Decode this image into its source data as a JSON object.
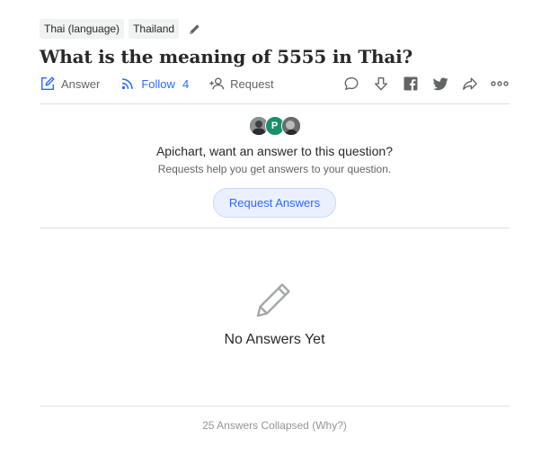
{
  "topics": [
    "Thai (language)",
    "Thailand"
  ],
  "question": {
    "title": "What is the meaning of 5555 in Thai?"
  },
  "actions": {
    "answer_label": "Answer",
    "follow_label": "Follow",
    "follow_count": "4",
    "request_label": "Request"
  },
  "request_panel": {
    "avatar_letter": "P",
    "prompt": "Apichart, want an answer to this question?",
    "subprompt": "Requests help you get answers to your question.",
    "button_label": "Request Answers"
  },
  "empty_state": {
    "icon": "pencil-icon",
    "text": "No Answers Yet"
  },
  "collapsed": {
    "text": "25 Answers Collapsed (Why?)"
  },
  "colors": {
    "accent": "#2e69ff",
    "text": "#282829",
    "muted": "#636466",
    "divider": "#dee0e1"
  }
}
